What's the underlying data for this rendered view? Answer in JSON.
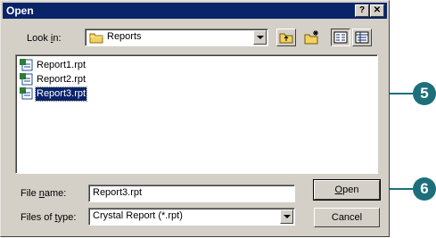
{
  "dialog": {
    "title": "Open",
    "help_button": "?",
    "close_button": "✕"
  },
  "look_in": {
    "label_pre": "Look ",
    "label_key": "i",
    "label_post": "n:",
    "value": "Reports"
  },
  "files": [
    {
      "name": "Report1.rpt",
      "selected": false
    },
    {
      "name": "Report2.rpt",
      "selected": false
    },
    {
      "name": "Report3.rpt",
      "selected": true
    }
  ],
  "file_name": {
    "label_pre": "File ",
    "label_key": "n",
    "label_post": "ame:",
    "value": "Report3.rpt"
  },
  "file_type": {
    "label_pre": "Files of ",
    "label_key": "t",
    "label_post": "ype:",
    "value": "Crystal Report (*.rpt)"
  },
  "buttons": {
    "open_key": "O",
    "open_rest": "pen",
    "cancel": "Cancel"
  },
  "callouts": {
    "step5": "5",
    "step6": "6"
  },
  "colors": {
    "titlebar": "#0a246a",
    "callout": "#1d6f7c",
    "face": "#d4d0c8"
  }
}
